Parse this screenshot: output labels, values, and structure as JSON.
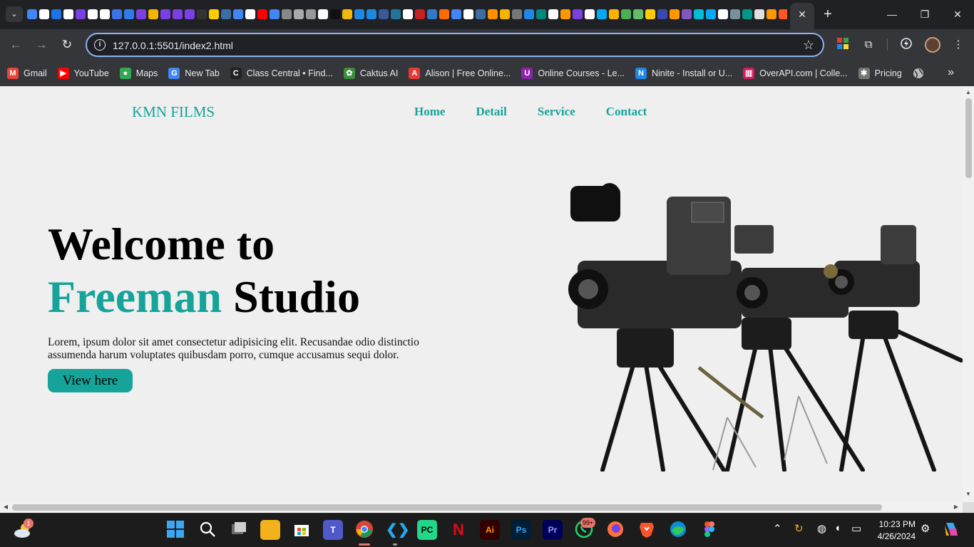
{
  "browser": {
    "active_tab_close": "✕",
    "new_tab": "+",
    "window_controls": {
      "minimize": "—",
      "restore": "❐",
      "close": "✕"
    },
    "pinned_favicons": [
      "#4285f4",
      "#ffffff",
      "#1a73e8",
      "#ffffff",
      "#7b3fe4",
      "#ffffff",
      "#ffffff",
      "#3c73e8",
      "#2b7de9",
      "#7b3fe4",
      "#f4b400",
      "#7b3fe4",
      "#7b3fe4",
      "#7b3fe4",
      "#333333",
      "#ffcc00",
      "#3a6ea5",
      "#4285f4",
      "#ffffff",
      "#ff0000",
      "#4285f4",
      "#888888",
      "#aaaaaa",
      "#999999",
      "#ffffff",
      "#111111",
      "#f0b90b",
      "#1e88e5",
      "#1e88e5",
      "#3b5998",
      "#21759b",
      "#ffffff",
      "#c5221f",
      "#3178c6",
      "#ff6d00",
      "#4285f4",
      "#ffffff",
      "#3a6ea5",
      "#ff9100",
      "#f4b400",
      "#777777",
      "#1e88e5",
      "#00897b",
      "#ffffff",
      "#ff9800",
      "#7b3fe4",
      "#ffffff",
      "#03a9f4",
      "#ffb300",
      "#4caf50",
      "#66bb6a",
      "#ffcc00",
      "#3949ab",
      "#ff9800",
      "#7e57c2",
      "#00bcd4",
      "#03a9f4",
      "#ffffff",
      "#78909c",
      "#009688",
      "#e0e0e0",
      "#ff9800",
      "#ff5722",
      "#21759b",
      "#ffeb3b",
      "#4caf50",
      "#1e88e5",
      "#ffd54f"
    ]
  },
  "toolbar": {
    "back_icon": "←",
    "forward_icon": "→",
    "reload_icon": "↻",
    "url": "127.0.0.1:5501/index2.html",
    "star_icon": "☆",
    "extensions_icon": "⧉",
    "menu_icon": "⋮"
  },
  "bookmarks": [
    {
      "label": "Gmail",
      "icon": "M",
      "color": "#ea4335"
    },
    {
      "label": "YouTube",
      "icon": "▶",
      "color": "#ff0000"
    },
    {
      "label": "Maps",
      "icon": "●",
      "color": "#34a853"
    },
    {
      "label": "New Tab",
      "icon": "G",
      "color": "#4285f4"
    },
    {
      "label": "Class Central • Find...",
      "icon": "C",
      "color": "#222222"
    },
    {
      "label": "Caktus AI",
      "icon": "✿",
      "color": "#3a8f3a"
    },
    {
      "label": "Alison | Free Online...",
      "icon": "A",
      "color": "#e53935"
    },
    {
      "label": "Online Courses - Le...",
      "icon": "U",
      "color": "#8e24aa"
    },
    {
      "label": "Ninite - Install or U...",
      "icon": "N",
      "color": "#1e88e5"
    },
    {
      "label": "OverAPI.com | Colle...",
      "icon": "▥",
      "color": "#d81b60"
    },
    {
      "label": "Pricing",
      "icon": "✱",
      "color": "#757575"
    }
  ],
  "bookmarks_more": "»",
  "page": {
    "logo": "KMN FILMS",
    "nav": [
      "Home",
      "Detail",
      "Service",
      "Contact"
    ],
    "hero": {
      "line1": "Welcome to",
      "accent": "Freeman",
      "line2_rest": " Studio",
      "description": "Lorem, ipsum dolor sit amet consectetur adipisicing elit. Recusandae odio distinctio assumenda harum voluptates quibusdam porro, cumque accusamus sequi dolor.",
      "button": "View here"
    },
    "accent_color": "#16a39a"
  },
  "taskbar": {
    "weather_badge": "1",
    "whatsapp_badge": "99+",
    "time": "10:23 PM",
    "date": "4/26/2024"
  }
}
